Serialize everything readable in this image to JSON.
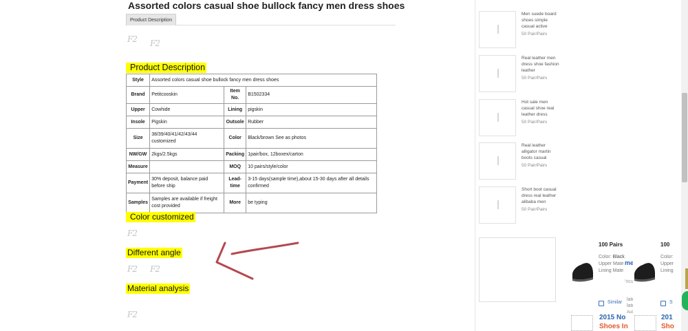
{
  "product": {
    "title": "Assorted colors casual shoe bullock fancy men dress shoes",
    "tab_label": "Product Description",
    "watermark": "F2"
  },
  "sections": {
    "product_description": "Product Description",
    "color_customized": "Color customized",
    "different_angle": "Different angle",
    "material_analysis": "Material analysis"
  },
  "spec_table": {
    "style_label": "Style",
    "style_value": "Assorted colors casual shoe bullock fancy men dress shoes",
    "rows": [
      {
        "k1": "Brand",
        "v1": "Petitcooskin",
        "k2": "Item No.",
        "v2": "B1502334"
      },
      {
        "k1": "Upper",
        "v1": "Cowhide",
        "k2": "Lining",
        "v2": "pigskin"
      },
      {
        "k1": "Insole",
        "v1": "Pigskin",
        "k2": "Outsole",
        "v2": "Rubber"
      },
      {
        "k1": "Size",
        "v1": "38/39/40/41/42/43/44 customized",
        "k2": "Color",
        "v2": "Black/brown See as photos"
      },
      {
        "k1": "NW/GW",
        "v1": "2kgs/2.5kgs",
        "k2": "Packing",
        "v2": "1pair/box, 12boxex/carton"
      },
      {
        "k1": "Measure",
        "v1": "",
        "k2": "MOQ",
        "v2": "10 pairs/style/color"
      },
      {
        "k1": "Payment",
        "v1": "30% deposit, balance paid before ship",
        "k2": "Lead-time",
        "v2": "3-15 days(sample time),about 15-30 days after all details confirmed"
      },
      {
        "k1": "Samples",
        "v1": "Samples are available if freight cost provided",
        "k2": "More",
        "v2": "be typing"
      }
    ]
  },
  "sidebar": {
    "items": [
      {
        "name": "Men suede board shoes simple casual active",
        "qty": "50 Pair/Pairs"
      },
      {
        "name": "Real leather men dress shoe fashion leather",
        "qty": "50 Pair/Pairs"
      },
      {
        "name": "Hot sale men casual shoe real leather dress",
        "qty": "50 Pair/Pairs"
      },
      {
        "name": "Real leather alligator martin boots casual",
        "qty": "50 Pair/Pairs"
      },
      {
        "name": "Short boot casual dress real leather alibaba men",
        "qty": "50 Pair/Pairs"
      }
    ]
  },
  "overlay": {
    "card1": {
      "qty": "100 Pairs",
      "color_label": "Color:",
      "color_value": "Black",
      "upper": "Upper Mate",
      "lining": "Lining Mate",
      "similar": "Similar"
    },
    "card2": {
      "qty": "100",
      "color_label": "Color:",
      "upper": "Upper",
      "lining": "Lining",
      "similar": "S"
    },
    "partial_me": "me",
    "partial_ricu": "'ricu",
    "partial_late1": "late",
    "partial_late2": "late",
    "partial_aut": "Aut",
    "promo1_a": "2015 No",
    "promo1_b": "Shoes In",
    "promo2_a": "201",
    "promo2_b": "Sho"
  }
}
